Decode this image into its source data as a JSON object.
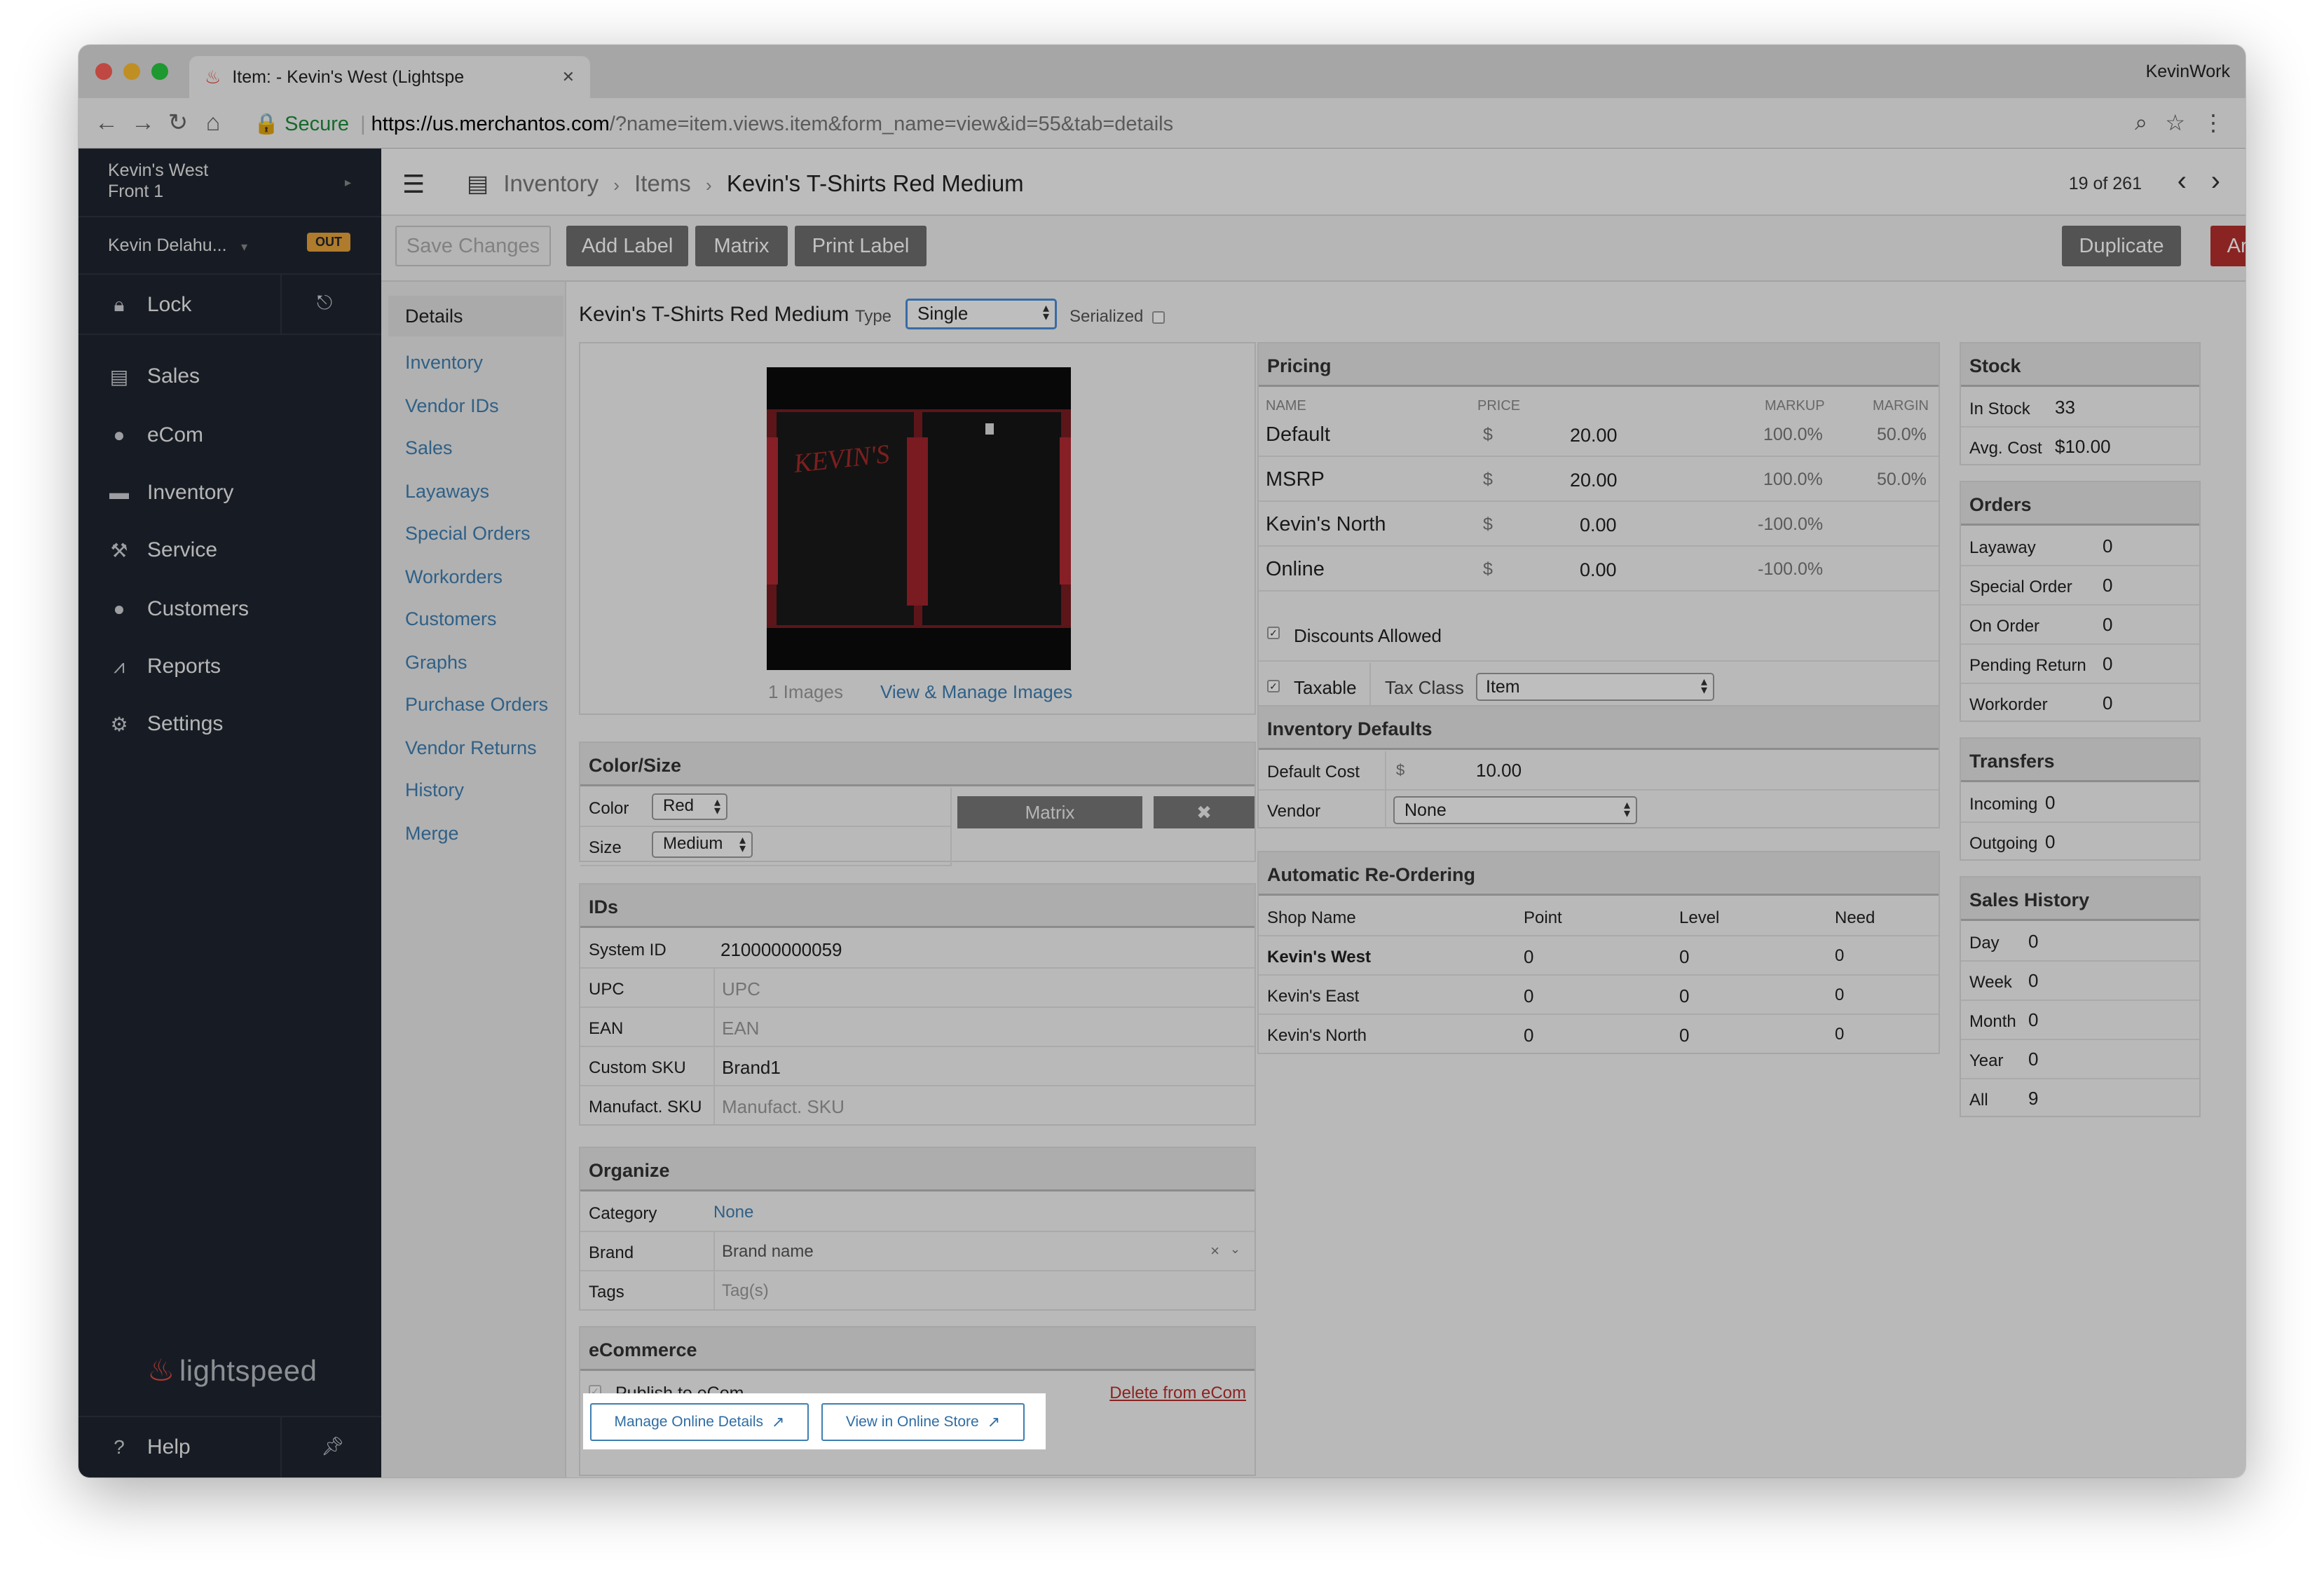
{
  "browser": {
    "tab_title": "Item: - Kevin's West (Lightspe",
    "profile": "KevinWork",
    "url_secure": "Secure",
    "url_host": "https://us.merchantos.com",
    "url_path": "/?name=item.views.item&form_name=view&id=55&tab=details"
  },
  "sidebar": {
    "store_line1": "Kevin's West",
    "store_line2": "Front 1",
    "user": "Kevin Delahu...",
    "status_badge": "OUT",
    "lock": "Lock",
    "items": [
      "Sales",
      "eCom",
      "Inventory",
      "Service",
      "Customers",
      "Reports",
      "Settings"
    ],
    "logo": "lightspeed",
    "help": "Help"
  },
  "header": {
    "breadcrumb": [
      "Inventory",
      "Items",
      "Kevin's T-Shirts Red Medium"
    ],
    "pager": "19 of 261"
  },
  "toolbar": {
    "save": "Save Changes",
    "add_label": "Add Label",
    "matrix": "Matrix",
    "print_label": "Print Label",
    "duplicate": "Duplicate",
    "archive": "Archive"
  },
  "subnav": [
    "Details",
    "Inventory",
    "Vendor IDs",
    "Sales",
    "Layaways",
    "Special Orders",
    "Workorders",
    "Customers",
    "Graphs",
    "Purchase Orders",
    "Vendor Returns",
    "History",
    "Merge"
  ],
  "item": {
    "title": "Kevin's T-Shirts Red Medium",
    "type_label": "Type",
    "type_value": "Single",
    "serialized_label": "Serialized",
    "images_count": "1 Images",
    "manage_images": "View & Manage Images",
    "image_text": "KEVIN'S"
  },
  "color_size": {
    "title": "Color/Size",
    "color_label": "Color",
    "color_value": "Red",
    "size_label": "Size",
    "size_value": "Medium",
    "matrix_btn": "Matrix",
    "remove_btn": "✖"
  },
  "ids": {
    "title": "IDs",
    "rows": [
      {
        "label": "System ID",
        "value": "210000000059"
      },
      {
        "label": "UPC",
        "value": "UPC"
      },
      {
        "label": "EAN",
        "value": "EAN"
      },
      {
        "label": "Custom SKU",
        "value": "Brand1"
      },
      {
        "label": "Manufact. SKU",
        "value": "Manufact. SKU"
      }
    ]
  },
  "organize": {
    "title": "Organize",
    "category_label": "Category",
    "category_value": "None",
    "brand_label": "Brand",
    "brand_value": "Brand name",
    "tags_label": "Tags",
    "tags_value": "Tag(s)"
  },
  "ecommerce": {
    "title": "eCommerce",
    "publish": "Publish to eCom",
    "delete": "Delete from eCom",
    "manage_btn": "Manage Online Details",
    "view_btn": "View in Online Store"
  },
  "pricing": {
    "title": "Pricing",
    "headers": {
      "name": "NAME",
      "price": "PRICE",
      "markup": "MARKUP",
      "margin": "MARGIN"
    },
    "rows": [
      {
        "name": "Default",
        "currency": "$",
        "price": "20.00",
        "markup": "100.0%",
        "margin": "50.0%"
      },
      {
        "name": "MSRP",
        "currency": "$",
        "price": "20.00",
        "markup": "100.0%",
        "margin": "50.0%"
      },
      {
        "name": "Kevin's North",
        "currency": "$",
        "price": "0.00",
        "markup": "-100.0%",
        "margin": ""
      },
      {
        "name": "Online",
        "currency": "$",
        "price": "0.00",
        "markup": "-100.0%",
        "margin": ""
      }
    ],
    "discounts": "Discounts Allowed",
    "taxable": "Taxable",
    "tax_class_label": "Tax Class",
    "tax_class_value": "Item"
  },
  "inventory_defaults": {
    "title": "Inventory Defaults",
    "cost_label": "Default Cost",
    "cost_currency": "$",
    "cost_value": "10.00",
    "vendor_label": "Vendor",
    "vendor_value": "None"
  },
  "reorder": {
    "title": "Automatic Re-Ordering",
    "headers": [
      "Shop Name",
      "Point",
      "Level",
      "Need"
    ],
    "rows": [
      {
        "shop": "Kevin's West",
        "point": "0",
        "level": "0",
        "need": "0"
      },
      {
        "shop": "Kevin's East",
        "point": "0",
        "level": "0",
        "need": "0"
      },
      {
        "shop": "Kevin's North",
        "point": "0",
        "level": "0",
        "need": "0"
      }
    ]
  },
  "stock": {
    "title": "Stock",
    "rows": [
      {
        "label": "In Stock",
        "value": "33"
      },
      {
        "label": "Avg. Cost",
        "value": "$10.00"
      }
    ]
  },
  "orders": {
    "title": "Orders",
    "rows": [
      {
        "label": "Layaway",
        "value": "0"
      },
      {
        "label": "Special Order",
        "value": "0"
      },
      {
        "label": "On Order",
        "value": "0"
      },
      {
        "label": "Pending Return",
        "value": "0"
      },
      {
        "label": "Workorder",
        "value": "0"
      }
    ]
  },
  "transfers": {
    "title": "Transfers",
    "rows": [
      {
        "label": "Incoming",
        "value": "0"
      },
      {
        "label": "Outgoing",
        "value": "0"
      }
    ]
  },
  "sales_history": {
    "title": "Sales History",
    "rows": [
      {
        "label": "Day",
        "value": "0"
      },
      {
        "label": "Week",
        "value": "0"
      },
      {
        "label": "Month",
        "value": "0"
      },
      {
        "label": "Year",
        "value": "0"
      },
      {
        "label": "All",
        "value": "9"
      }
    ]
  }
}
